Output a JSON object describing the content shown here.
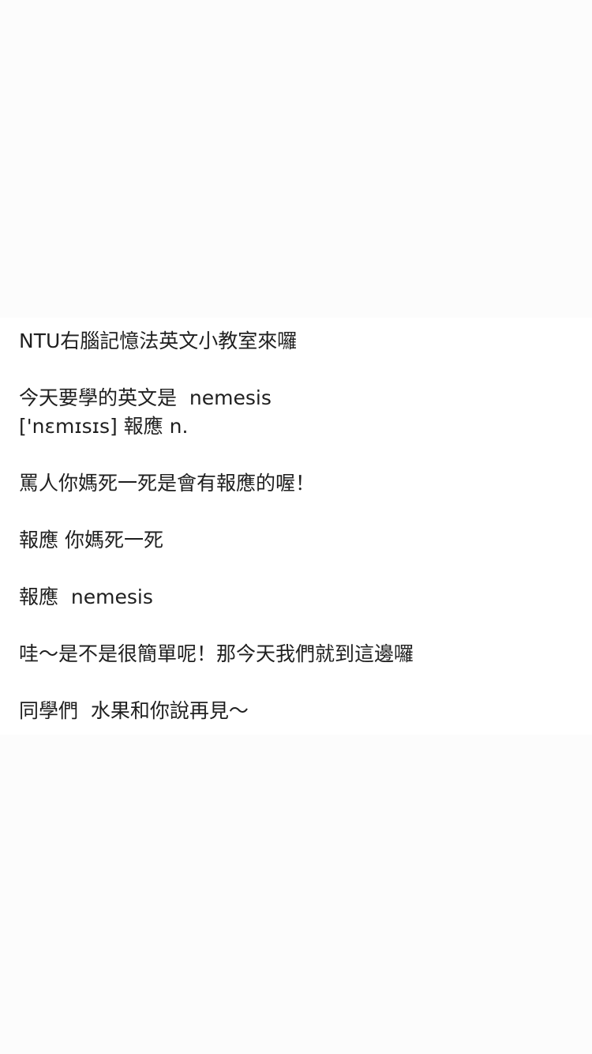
{
  "post": {
    "lines": [
      "NTU右腦記憶法英文小教室來囉",
      "",
      "今天要學的英文是  nemesis",
      "['nɛmɪsɪs] 報應 n.",
      "",
      "罵人你媽死一死是會有報應的喔！",
      "",
      "報應 你媽死一死",
      "",
      "報應  nemesis",
      "",
      "哇～是不是很簡單呢！那今天我們就到這邊囉",
      "",
      "同學們  水果和你說再見～"
    ]
  }
}
